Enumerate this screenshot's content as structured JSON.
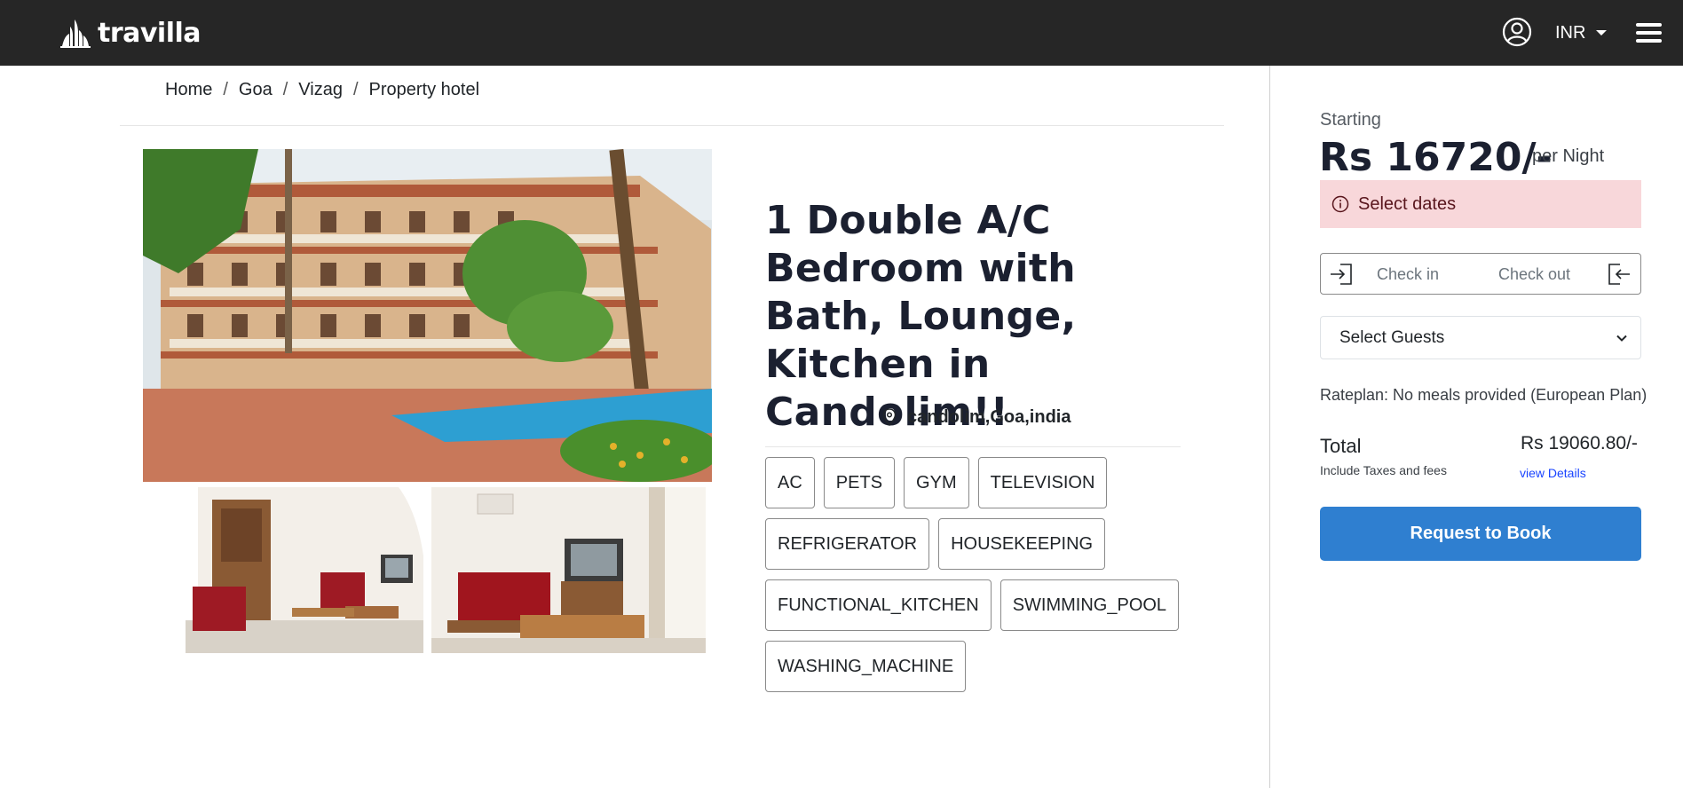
{
  "header": {
    "brand": "travilla",
    "currency": "INR",
    "colors": {
      "bar": "#262626",
      "text": "#ffffff"
    }
  },
  "breadcrumb": [
    "Home",
    "Goa",
    "Vizag",
    "Property hotel"
  ],
  "breadcrumb_separator": "/",
  "listing": {
    "title": "1 Double A/C Bedroom with Bath, Lounge, Kitchen in Candolim!!",
    "location": "candolim,Goa,india",
    "amenities": [
      "AC",
      "PETS",
      "GYM",
      "TELEVISION",
      "REFRIGERATOR",
      "HOUSEKEEPING",
      "FUNCTIONAL_KITCHEN",
      "SWIMMING_POOL",
      "WASHING_MACHINE"
    ]
  },
  "booking": {
    "starting_label": "Starting",
    "price": "Rs 16720/-",
    "per_night": "per Night",
    "alert": "Select dates",
    "check_in": "Check in",
    "check_out": "Check out",
    "guests_placeholder": "Select Guests",
    "rateplan": "Rateplan: No meals provided (European Plan)",
    "total_label": "Total",
    "taxes_note": "Include Taxes and fees",
    "total_amount": "Rs 19060.80/-",
    "view_details": "view Details",
    "book_button": "Request to Book",
    "colors": {
      "alert_bg": "#f8d7da",
      "button": "#2f7fd0",
      "link": "#1a44ff"
    }
  }
}
